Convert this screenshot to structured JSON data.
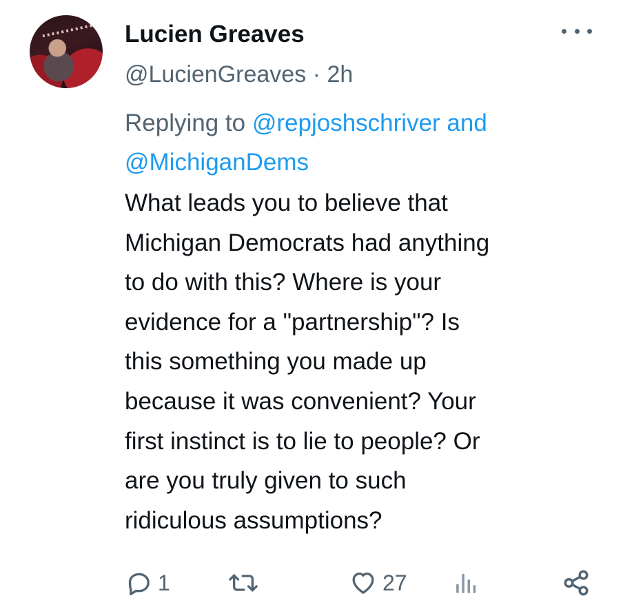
{
  "tweet": {
    "display_name": "Lucien Greaves",
    "handle": "@LucienGreaves",
    "separator": "·",
    "time": "2h",
    "replying_prefix": "Replying to",
    "reply_to_1": "@repjoshschriver",
    "reply_joiner": "and",
    "reply_to_2": "@MichiganDems",
    "body_lines": [
      "What leads you to believe that",
      "Michigan Democrats had anything",
      "to do with this? Where is your",
      "evidence for a \"partnership\"? Is",
      "this something you made up",
      "because it was convenient? Your",
      "first instinct is to lie to people? Or",
      "are you truly given to such",
      "ridiculous assumptions?"
    ]
  },
  "actions": {
    "reply_count": "1",
    "retweet_count": "",
    "like_count": "27",
    "views_count": ""
  },
  "icons": {
    "reply": "reply-bubble-icon",
    "retweet": "retweet-icon",
    "like": "heart-icon",
    "views": "views-bar-icon",
    "share": "share-icon",
    "more": "more-dots-icon"
  },
  "colors": {
    "text": "#0f1419",
    "secondary": "#536471",
    "link": "#1d9bf0"
  }
}
